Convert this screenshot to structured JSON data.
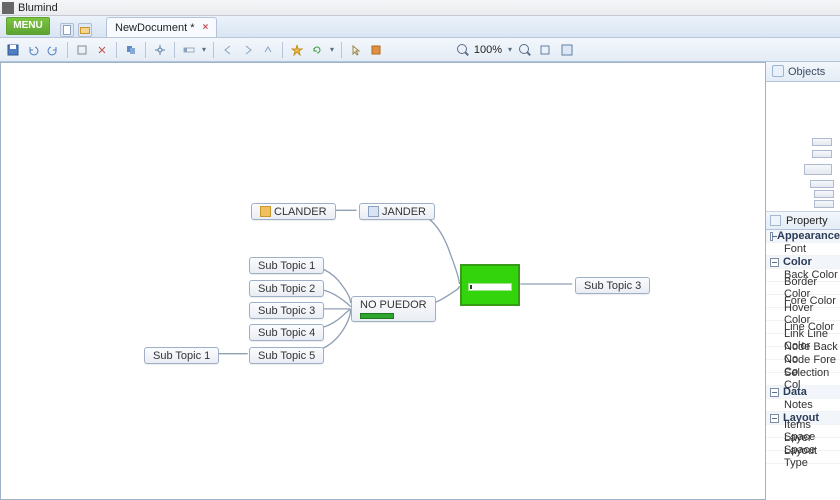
{
  "app": {
    "title": "Blumind"
  },
  "menu": {
    "button": "MENU"
  },
  "tabs": [
    {
      "title": "NewDocument *"
    }
  ],
  "toolbar": {
    "zoom": "100%",
    "icons": {
      "save": "save-icon",
      "undo": "undo-icon",
      "redo": "redo-icon",
      "cut": "cut-icon",
      "delete": "delete-icon",
      "find": "find-icon",
      "pan": "pan-icon",
      "node": "node-icon",
      "back": "back-icon",
      "fwd": "fwd-icon",
      "up": "up-icon",
      "star": "star-icon",
      "refresh": "refresh-icon",
      "pointer": "pointer-icon",
      "flag": "flag-icon",
      "fit": "fit-icon",
      "full": "full-icon"
    }
  },
  "nodes": {
    "clander": "CLANDER",
    "jander": "JANDER",
    "puedor": "NO PUEDOR",
    "bigtxt": "",
    "sub1": "Sub Topic 1",
    "sub2": "Sub Topic 2",
    "sub3": "Sub Topic 3",
    "sub4": "Sub Topic 4",
    "sub5": "Sub Topic 5",
    "sub1b": "Sub Topic 1",
    "sub3r": "Sub Topic 3"
  },
  "side": {
    "objects": "Objects",
    "property": "Property",
    "cats": {
      "appearance": "Appearance",
      "color": "Color",
      "data": "Data",
      "layout": "Layout"
    },
    "props": {
      "font": "Font",
      "back": "Back Color",
      "border": "Border Color",
      "fore": "Fore Color",
      "hover": "Hover Color",
      "line": "Line Color",
      "linkline": "Link Line Color",
      "nodeback": "Node Back Co",
      "nodefore": "Node Fore Co",
      "selection": "Selection Col",
      "notes": "Notes",
      "items": "Items Space",
      "layer": "Layer Space",
      "layouttype": "Layout Type"
    }
  }
}
